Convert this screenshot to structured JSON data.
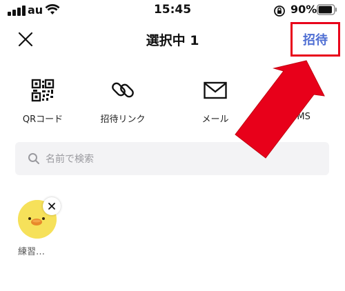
{
  "status_bar": {
    "carrier": "au",
    "time": "15:45",
    "battery_percent": "90%",
    "battery_level": 0.9,
    "icons": [
      "signal-icon",
      "wifi-icon",
      "rotation-lock-icon",
      "battery-icon"
    ]
  },
  "header": {
    "title": "選択中 1",
    "invite_label": "招待",
    "close_icon": "close-icon"
  },
  "share_options": [
    {
      "label": "QRコード",
      "icon": "qr-code-icon"
    },
    {
      "label": "招待リンク",
      "icon": "link-icon"
    },
    {
      "label": "メール",
      "icon": "mail-icon"
    },
    {
      "label": "SMS",
      "icon": "sms-icon"
    }
  ],
  "search": {
    "placeholder": "名前で検索",
    "value": ""
  },
  "selected_friends": [
    {
      "name": "練習…",
      "avatar_icon": "chick-avatar"
    }
  ],
  "colors": {
    "accent_blue": "#4f6fd3",
    "highlight_red": "#e8001a",
    "avatar_yellow": "#f6e15a",
    "search_bg": "#f3f3f5"
  }
}
